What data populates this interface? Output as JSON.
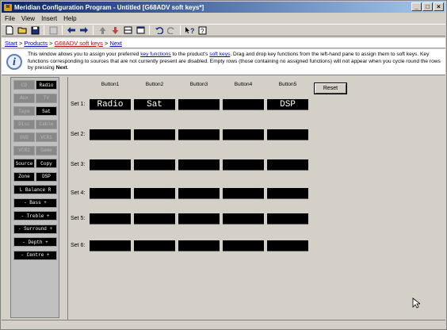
{
  "window": {
    "title": "Meridian Configuration Program - Untitled [G68ADV soft keys*]",
    "app_icon_text": "M",
    "min": "_",
    "max": "□",
    "close": "×"
  },
  "menu": [
    "File",
    "View",
    "Insert",
    "Help"
  ],
  "breadcrumb": {
    "items": [
      "Start",
      "Products",
      "G68ADV soft keys",
      "Next"
    ],
    "separator": ">"
  },
  "info": {
    "line_a": "This window allows you to assign your preferred",
    "kw1": "key functions",
    "line_b": "to the product's",
    "kw2": "soft keys",
    "line_c": ". Drag and drop key functions from the left-hand pane to assign them to soft keys. Key functions corresponding to sources that are not currently present are disabled. Empty rows (those containing no assigned functions) will not appear when you cycle round the rows by pressing",
    "kw3": "Next",
    "end": "."
  },
  "key_functions": [
    {
      "label": "CD",
      "enabled": false
    },
    {
      "label": "Radio",
      "enabled": true
    },
    {
      "label": "Aux",
      "enabled": false
    },
    {
      "label": "TV",
      "enabled": false
    },
    {
      "label": "Tape",
      "enabled": false
    },
    {
      "label": "Sat",
      "enabled": true
    },
    {
      "label": "Disc",
      "enabled": false
    },
    {
      "label": "Cable",
      "enabled": false
    },
    {
      "label": "DVD",
      "enabled": false
    },
    {
      "label": "VCR1",
      "enabled": false
    },
    {
      "label": "VCR2",
      "enabled": false
    },
    {
      "label": "Game",
      "enabled": false
    },
    {
      "label": "Source",
      "enabled": true
    },
    {
      "label": "Copy",
      "enabled": true
    },
    {
      "label": "Zone",
      "enabled": true
    },
    {
      "label": "DSP",
      "enabled": true
    },
    {
      "label": "L Balance R",
      "enabled": true
    },
    {
      "label": "- Bass +",
      "enabled": true
    },
    {
      "label": "- Treble +",
      "enabled": true
    },
    {
      "label": "- Surround +",
      "enabled": true
    },
    {
      "label": "- Depth +",
      "enabled": true
    },
    {
      "label": "- Centre +",
      "enabled": true
    }
  ],
  "columns": [
    "Button1",
    "Button2",
    "Button3",
    "Button4",
    "Button5"
  ],
  "rows": [
    {
      "label": "Set 1:",
      "cells": [
        "Radio",
        "Sat",
        "",
        "",
        "DSP"
      ]
    },
    {
      "label": "Set 2:",
      "cells": [
        "",
        "",
        "",
        "",
        ""
      ]
    },
    {
      "label": "Set 3:",
      "cells": [
        "",
        "",
        "",
        "",
        ""
      ]
    },
    {
      "label": "Set 4:",
      "cells": [
        "",
        "",
        "",
        "",
        ""
      ]
    },
    {
      "label": "Set 5:",
      "cells": [
        "",
        "",
        "",
        "",
        ""
      ]
    },
    {
      "label": "Set 6:",
      "cells": [
        "",
        "",
        "",
        "",
        ""
      ]
    }
  ],
  "reset_label": "Reset"
}
